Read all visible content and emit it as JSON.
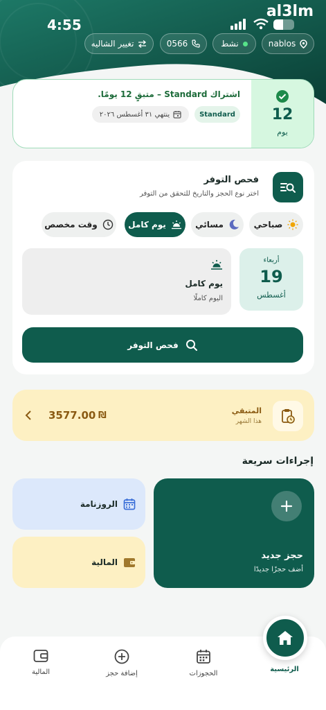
{
  "status_bar": {
    "time": "4:55",
    "brand": "al3lm"
  },
  "header_chips": {
    "location": "nablos",
    "status": "نشط",
    "phone": "0566",
    "switch": "تغيير الشاليه"
  },
  "subscription": {
    "days": "12",
    "days_label": "يوم",
    "title": "اشتراك Standard – متبقٍ 12 يومًا.",
    "plan": "Standard",
    "expiry": "ينتهي ٣١ أغسطس ٢٠٢٦"
  },
  "availability": {
    "title": "فحص التوفر",
    "subtitle": "اختر نوع الحجز والتاريخ للتحقق من التوفر",
    "segments": [
      "صباحي",
      "مسائي",
      "يوم كامل",
      "وقت مخصص"
    ],
    "selected_segment": "يوم كامل",
    "slot_name": "يوم كامل",
    "slot_desc": "اليوم كاملًا",
    "day_name": "أربعاء",
    "day_num": "19",
    "month": "أغسطس",
    "button": "فحص التوفر"
  },
  "remaining": {
    "label": "المتبقي",
    "sub": "هذا الشهر",
    "amount": "3577.00",
    "currency": "₪"
  },
  "quick_actions": {
    "title": "إجراءات سريعة",
    "new_booking": "حجز جديد",
    "new_booking_sub": "أضف حجزًا جديدًا",
    "calendar": "الروزنامة",
    "finance": "المالية"
  },
  "nav": {
    "home": "الرئيسية",
    "bookings": "الحجوزات",
    "add": "إضافة حجز",
    "finance": "المالية"
  },
  "colors": {
    "primary": "#0f5c4d",
    "accent_green": "#d6f7e0",
    "remaining_bg": "#fdf0c3",
    "calendar_bg": "#dce8fb",
    "finance_bg": "#fdf0c3"
  }
}
